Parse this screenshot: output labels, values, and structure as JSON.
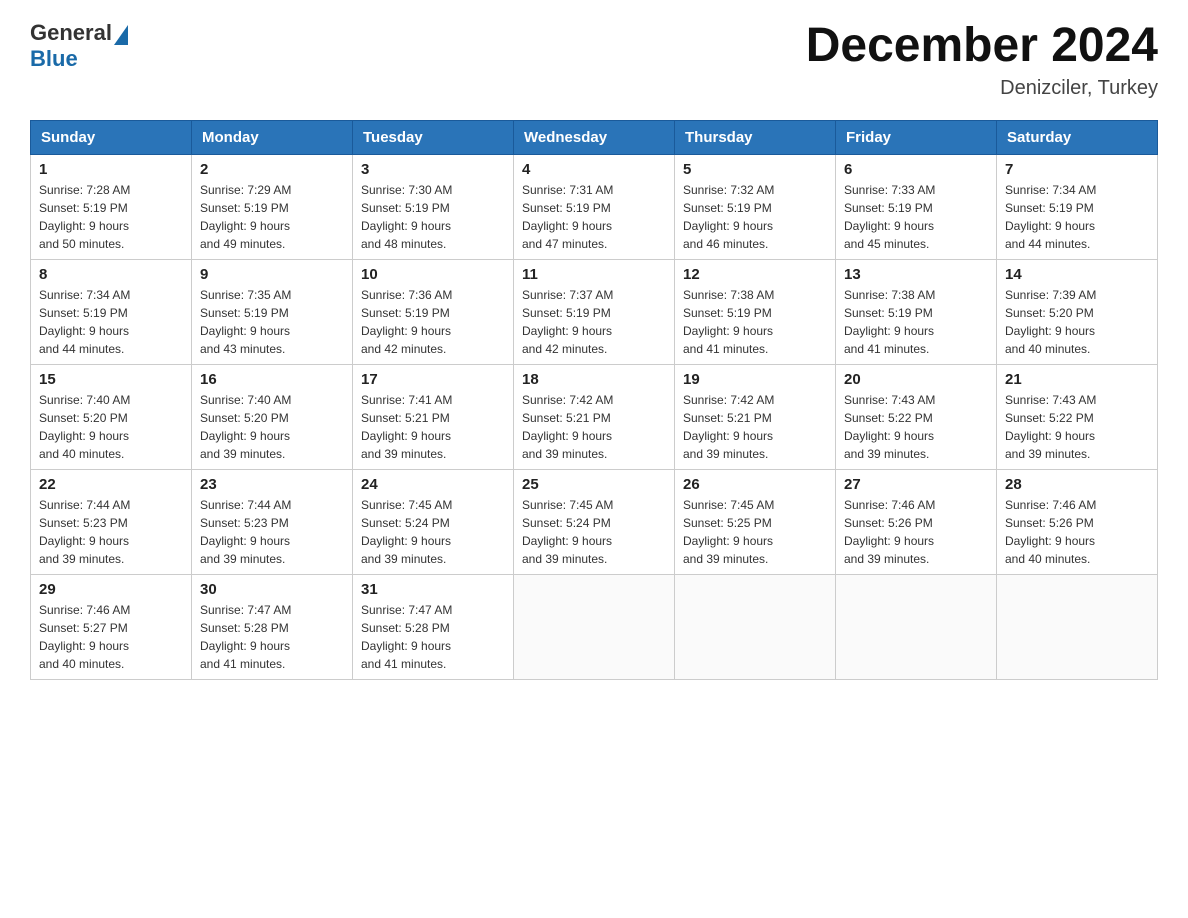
{
  "header": {
    "logo_general": "General",
    "logo_blue": "Blue",
    "title": "December 2024",
    "location": "Denizciler, Turkey"
  },
  "weekdays": [
    "Sunday",
    "Monday",
    "Tuesday",
    "Wednesday",
    "Thursday",
    "Friday",
    "Saturday"
  ],
  "weeks": [
    [
      {
        "day": "1",
        "sunrise": "7:28 AM",
        "sunset": "5:19 PM",
        "daylight": "9 hours and 50 minutes."
      },
      {
        "day": "2",
        "sunrise": "7:29 AM",
        "sunset": "5:19 PM",
        "daylight": "9 hours and 49 minutes."
      },
      {
        "day": "3",
        "sunrise": "7:30 AM",
        "sunset": "5:19 PM",
        "daylight": "9 hours and 48 minutes."
      },
      {
        "day": "4",
        "sunrise": "7:31 AM",
        "sunset": "5:19 PM",
        "daylight": "9 hours and 47 minutes."
      },
      {
        "day": "5",
        "sunrise": "7:32 AM",
        "sunset": "5:19 PM",
        "daylight": "9 hours and 46 minutes."
      },
      {
        "day": "6",
        "sunrise": "7:33 AM",
        "sunset": "5:19 PM",
        "daylight": "9 hours and 45 minutes."
      },
      {
        "day": "7",
        "sunrise": "7:34 AM",
        "sunset": "5:19 PM",
        "daylight": "9 hours and 44 minutes."
      }
    ],
    [
      {
        "day": "8",
        "sunrise": "7:34 AM",
        "sunset": "5:19 PM",
        "daylight": "9 hours and 44 minutes."
      },
      {
        "day": "9",
        "sunrise": "7:35 AM",
        "sunset": "5:19 PM",
        "daylight": "9 hours and 43 minutes."
      },
      {
        "day": "10",
        "sunrise": "7:36 AM",
        "sunset": "5:19 PM",
        "daylight": "9 hours and 42 minutes."
      },
      {
        "day": "11",
        "sunrise": "7:37 AM",
        "sunset": "5:19 PM",
        "daylight": "9 hours and 42 minutes."
      },
      {
        "day": "12",
        "sunrise": "7:38 AM",
        "sunset": "5:19 PM",
        "daylight": "9 hours and 41 minutes."
      },
      {
        "day": "13",
        "sunrise": "7:38 AM",
        "sunset": "5:19 PM",
        "daylight": "9 hours and 41 minutes."
      },
      {
        "day": "14",
        "sunrise": "7:39 AM",
        "sunset": "5:20 PM",
        "daylight": "9 hours and 40 minutes."
      }
    ],
    [
      {
        "day": "15",
        "sunrise": "7:40 AM",
        "sunset": "5:20 PM",
        "daylight": "9 hours and 40 minutes."
      },
      {
        "day": "16",
        "sunrise": "7:40 AM",
        "sunset": "5:20 PM",
        "daylight": "9 hours and 39 minutes."
      },
      {
        "day": "17",
        "sunrise": "7:41 AM",
        "sunset": "5:21 PM",
        "daylight": "9 hours and 39 minutes."
      },
      {
        "day": "18",
        "sunrise": "7:42 AM",
        "sunset": "5:21 PM",
        "daylight": "9 hours and 39 minutes."
      },
      {
        "day": "19",
        "sunrise": "7:42 AM",
        "sunset": "5:21 PM",
        "daylight": "9 hours and 39 minutes."
      },
      {
        "day": "20",
        "sunrise": "7:43 AM",
        "sunset": "5:22 PM",
        "daylight": "9 hours and 39 minutes."
      },
      {
        "day": "21",
        "sunrise": "7:43 AM",
        "sunset": "5:22 PM",
        "daylight": "9 hours and 39 minutes."
      }
    ],
    [
      {
        "day": "22",
        "sunrise": "7:44 AM",
        "sunset": "5:23 PM",
        "daylight": "9 hours and 39 minutes."
      },
      {
        "day": "23",
        "sunrise": "7:44 AM",
        "sunset": "5:23 PM",
        "daylight": "9 hours and 39 minutes."
      },
      {
        "day": "24",
        "sunrise": "7:45 AM",
        "sunset": "5:24 PM",
        "daylight": "9 hours and 39 minutes."
      },
      {
        "day": "25",
        "sunrise": "7:45 AM",
        "sunset": "5:24 PM",
        "daylight": "9 hours and 39 minutes."
      },
      {
        "day": "26",
        "sunrise": "7:45 AM",
        "sunset": "5:25 PM",
        "daylight": "9 hours and 39 minutes."
      },
      {
        "day": "27",
        "sunrise": "7:46 AM",
        "sunset": "5:26 PM",
        "daylight": "9 hours and 39 minutes."
      },
      {
        "day": "28",
        "sunrise": "7:46 AM",
        "sunset": "5:26 PM",
        "daylight": "9 hours and 40 minutes."
      }
    ],
    [
      {
        "day": "29",
        "sunrise": "7:46 AM",
        "sunset": "5:27 PM",
        "daylight": "9 hours and 40 minutes."
      },
      {
        "day": "30",
        "sunrise": "7:47 AM",
        "sunset": "5:28 PM",
        "daylight": "9 hours and 41 minutes."
      },
      {
        "day": "31",
        "sunrise": "7:47 AM",
        "sunset": "5:28 PM",
        "daylight": "9 hours and 41 minutes."
      },
      null,
      null,
      null,
      null
    ]
  ],
  "labels": {
    "sunrise": "Sunrise:",
    "sunset": "Sunset:",
    "daylight": "Daylight:"
  }
}
